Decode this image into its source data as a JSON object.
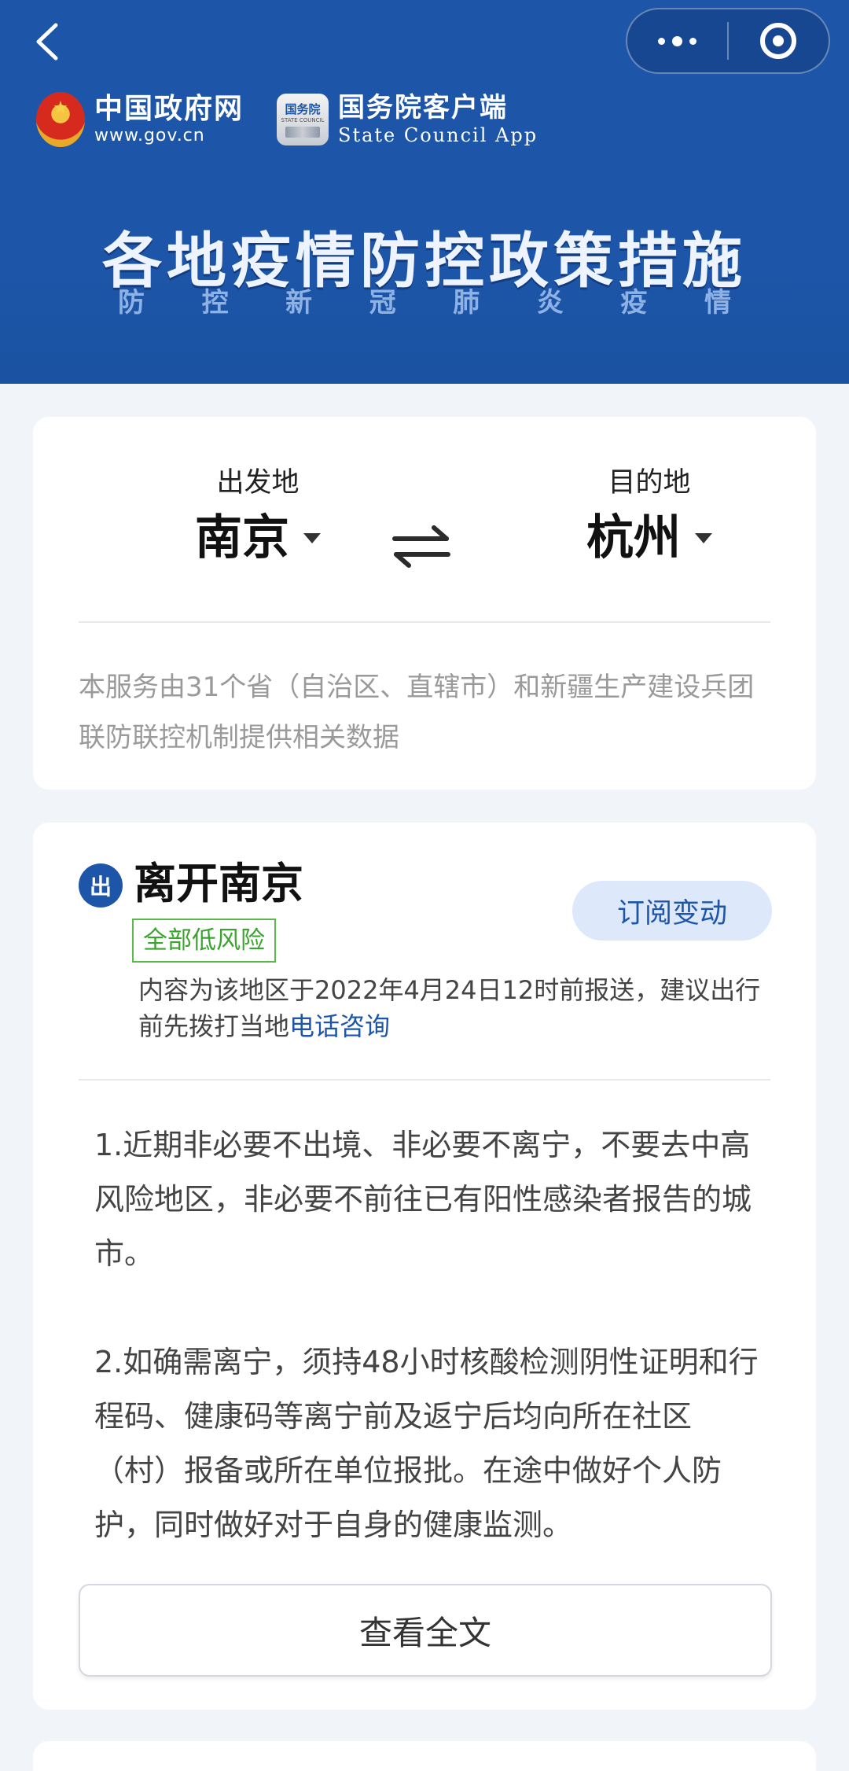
{
  "header": {
    "gov_site": {
      "name": "中国政府网",
      "url_text": "www.gov.cn"
    },
    "council_app": {
      "icon_text": "国务院",
      "icon_sub": "STATE COUNCIL",
      "name": "国务院客户端",
      "name_en": "State Council App"
    },
    "title": "各地疫情防控政策措施",
    "subtitle_chars": [
      "防",
      "控",
      "新",
      "冠",
      "肺",
      "炎",
      "疫",
      "情"
    ],
    "colors": {
      "bg": "#1d56a8"
    }
  },
  "route": {
    "from_label": "出发地",
    "from_city": "南京",
    "to_label": "目的地",
    "to_city": "杭州",
    "note": "本服务由31个省（自治区、直辖市）和新疆生产建设兵团联防联控机制提供相关数据"
  },
  "leave": {
    "badge": "出",
    "title": "离开南京",
    "risk_tag": "全部低风险",
    "subscribe_label": "订阅变动",
    "report_note": "内容为该地区于2022年4月24日12时前报送，建议出行前先拨打当地",
    "phone_link": "电话咨询",
    "policies": [
      "1.近期非必要不出境、非必要不离宁，不要去中高风险地区，非必要不前往已有阳性感染者报告的城市。",
      "2.如确需离宁，须持48小时核酸检测阴性证明和行程码、健康码等离宁前及返宁后均向所在社区（村）报备或所在单位报批。在途中做好个人防护，同时做好对于自身的健康监测。"
    ],
    "full_text_label": "查看全文"
  }
}
